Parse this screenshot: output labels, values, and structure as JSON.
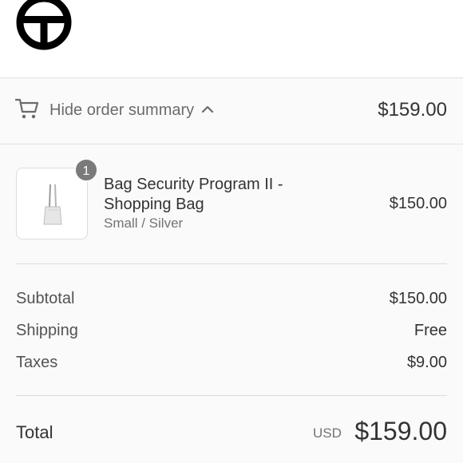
{
  "header": {
    "logo_icon": "telfar-logo-icon"
  },
  "summary_toggle": {
    "icon": "shopping-cart-icon",
    "label": "Hide order summary",
    "chevron": "chevron-up-icon",
    "total": "$159.00"
  },
  "line_item": {
    "quantity": "1",
    "name": "Bag Security Program II - Shopping Bag",
    "variant": "Small / Silver",
    "price": "$150.00",
    "image_icon": "shopping-bag-thumbnail"
  },
  "costs": {
    "subtotal_label": "Subtotal",
    "subtotal_value": "$150.00",
    "shipping_label": "Shipping",
    "shipping_value": "Free",
    "taxes_label": "Taxes",
    "taxes_value": "$9.00"
  },
  "total": {
    "label": "Total",
    "currency": "USD",
    "value": "$159.00"
  },
  "colors": {
    "text": "#333333",
    "muted": "#737373",
    "panel_bg": "#fafafa",
    "border": "#e1e1e1",
    "badge": "#7a7a7a"
  }
}
